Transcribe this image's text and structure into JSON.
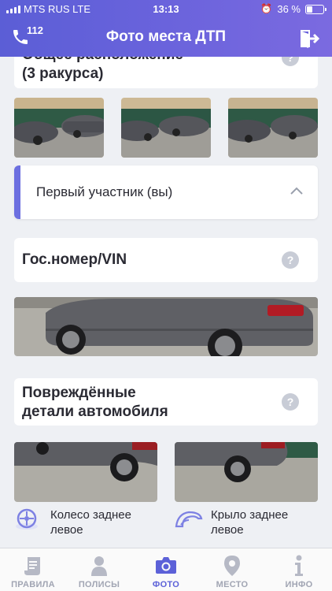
{
  "status": {
    "carrier": "MTS RUS  LTE",
    "time": "13:13",
    "battery": "36 %"
  },
  "nav": {
    "title": "Фото места ДТП",
    "call_number": "112"
  },
  "sections": {
    "overall": {
      "title_line1": "Общее расположение",
      "title_line2": "(3 ракурса)",
      "help": "?"
    },
    "participant": {
      "label": "Первый участник (вы)"
    },
    "plate": {
      "title": "Гос.номер/VIN",
      "help": "?"
    },
    "damaged": {
      "title_line1": "Повреждённые",
      "title_line2": "детали автомобиля",
      "help": "?"
    },
    "parts": [
      {
        "line1": "Колесо заднее",
        "line2": "левое",
        "icon": "wheel-icon"
      },
      {
        "line1": "Крыло заднее",
        "line2": "левое",
        "icon": "fender-icon"
      }
    ]
  },
  "tabs": [
    {
      "label": "ПРАВИЛА",
      "icon": "scroll-icon",
      "active": false
    },
    {
      "label": "ПОЛИСЫ",
      "icon": "person-icon",
      "active": false
    },
    {
      "label": "ФОТО",
      "icon": "camera-icon",
      "active": true
    },
    {
      "label": "МЕСТО",
      "icon": "location-pin-icon",
      "active": false
    },
    {
      "label": "ИНФО",
      "icon": "info-icon",
      "active": false
    }
  ],
  "colors": {
    "header_start": "#5b5ed6",
    "header_end": "#7b6ae0",
    "accent": "#5c61d8",
    "tab_inactive": "#a1a5b3",
    "help_badge": "#c8ccd6"
  }
}
